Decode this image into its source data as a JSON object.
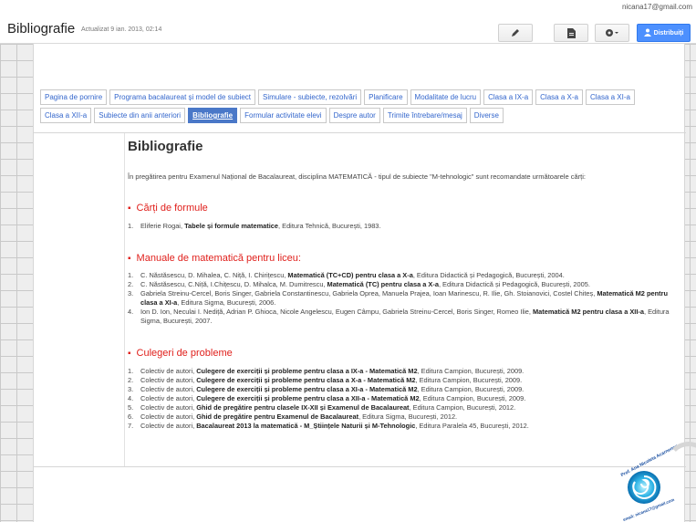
{
  "header": {
    "title": "Bibliografie",
    "updated": "Actualizat 9 ian. 2013, 02:14",
    "user_email": "nicana17@gmail.com",
    "share_label": "Distribuiți",
    "icons": [
      "pencil-icon",
      "page-icon",
      "gear-icon",
      "share-person-icon"
    ]
  },
  "nav": {
    "tabs": [
      {
        "label": "Pagina de pornire",
        "active": false
      },
      {
        "label": "Programa bacalaureat și model de subiect",
        "active": false
      },
      {
        "label": "Simulare - subiecte, rezolvări",
        "active": false
      },
      {
        "label": "Planificare",
        "active": false
      },
      {
        "label": "Modalitate de lucru",
        "active": false
      },
      {
        "label": "Clasa a IX-a",
        "active": false
      },
      {
        "label": "Clasa a X-a",
        "active": false
      },
      {
        "label": "Clasa a XI-a",
        "active": false
      },
      {
        "label": "Clasa a XII-a",
        "active": false
      },
      {
        "label": "Subiecte din anii anteriori",
        "active": false
      },
      {
        "label": "Bibliografie",
        "active": true
      },
      {
        "label": "Formular activitate elevi",
        "active": false
      },
      {
        "label": "Despre autor",
        "active": false
      },
      {
        "label": "Trimite întrebare/mesaj",
        "active": false
      },
      {
        "label": "Diverse",
        "active": false
      }
    ]
  },
  "main": {
    "title": "Bibliografie",
    "intro": "În pregătirea pentru Examenul Național de Bacalaureat, disciplina MATEMATICĂ - tipul de subiecte \"M-tehnologic\" sunt recomandate următoarele cărți:",
    "sections": [
      {
        "heading": "Cărți de formule",
        "items": [
          {
            "num": "1.",
            "pre": "Eliferie Rogai, ",
            "bold": "Tabele și formule matematice",
            "post": ", Editura Tehnică, București, 1983."
          }
        ]
      },
      {
        "heading": "Manuale de matematică pentru liceu:",
        "items": [
          {
            "num": "1.",
            "pre": "C. Năstăsescu, D. Mihalea, C. Niță, I. Chirițescu, ",
            "bold": "Matematică (TC+CD) pentru clasa a X-a",
            "post": ", Editura Didactică și Pedagogică, București, 2004."
          },
          {
            "num": "2.",
            "pre": "C. Năstăsescu, C.Niță, I.Chițescu, D. Mihalca, M. Dumitrescu, ",
            "bold": "Matematică (TC) pentru clasa a X-a",
            "post": ", Editura Didactică și Pedagogică, București, 2005."
          },
          {
            "num": "3.",
            "pre": "Gabriela Streinu-Cercel, Boris Singer, Gabriela Constantinescu, Gabriela Oprea, Manuela Prajea, Ioan Marinescu, R. Ilie, Gh. Stoianovici, Costel Chiteș, ",
            "bold": "Matematică M2 pentru clasa a XI-a",
            "post": ", Editura Sigma, București, 2006."
          },
          {
            "num": "4.",
            "pre": "Ion D. Ion, Neculai I. Nediță, Adrian P. Ghioca, Nicole Angelescu, Eugen Câmpu, Gabriela Streinu-Cercel, Boris Singer, Romeo Ilie, ",
            "bold": "Matematică M2 pentru clasa a XII-a",
            "post": ", Editura Sigma, București, 2007."
          }
        ]
      },
      {
        "heading": "Culegeri de probleme",
        "items": [
          {
            "num": "1.",
            "pre": "Colectiv de autori, ",
            "bold": "Culegere de exerciții și probleme pentru clasa a IX-a - Matematică M2",
            "post": ", Editura Campion, București, 2009."
          },
          {
            "num": "2.",
            "pre": "Colectiv de autori, ",
            "bold": "Culegere de exerciții și probleme pentru clasa a X-a - Matematică M2",
            "post": ", Editura Campion, București, 2009."
          },
          {
            "num": "3.",
            "pre": "Colectiv de autori, ",
            "bold": "Culegere de exerciții și probleme pentru clasa a XI-a - Matematică M2",
            "post": ", Editura Campion, București, 2009."
          },
          {
            "num": "4.",
            "pre": "Colectiv de autori, ",
            "bold": "Culegere de exerciții și probleme pentru clasa a XII-a - Matematică M2",
            "post": ", Editura Campion, București, 2009."
          },
          {
            "num": "5.",
            "pre": "Colectiv de autori, ",
            "bold": "Ghid de pregătire pentru clasele IX-XII și Examenul de Bacalaureat",
            "post": ", Editura Campion, București, 2012."
          },
          {
            "num": "6.",
            "pre": "Colectiv de autori, ",
            "bold": "Ghid de pregătire pentru Examenul de Bacalaureat",
            "post": ", Editura Sigma, București, 2012."
          },
          {
            "num": "7.",
            "pre": "Colectiv de autori, ",
            "bold": "Bacalaureat 2013 la matematică - M_Științele Naturii și M-Tehnologic",
            "post": ", Editura Paralela 45, București, 2012."
          }
        ]
      }
    ]
  },
  "logo": {
    "text_top": "Prof. Ana Nicoleta Acarnencu",
    "text_bottom": "email: nicana17@gmail.com"
  },
  "colors": {
    "accent": "#4d90fe",
    "heading_red": "#e0201c",
    "link_blue": "#3366cc",
    "active_tab": "#4a78c8"
  }
}
